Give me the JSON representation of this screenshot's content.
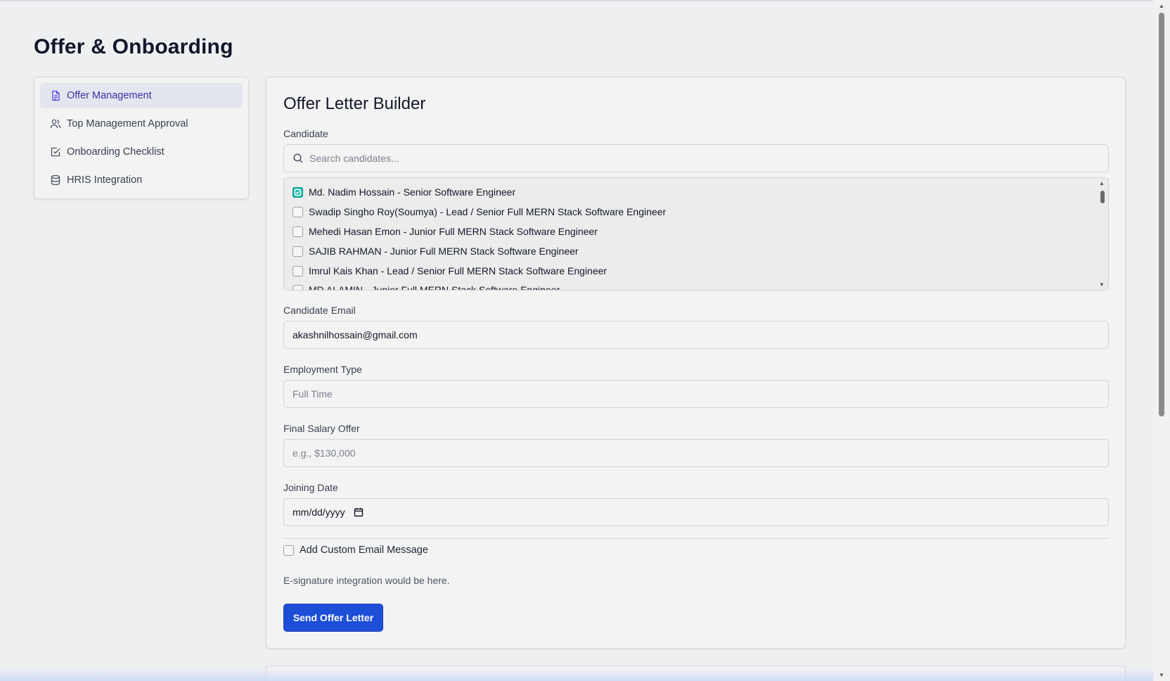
{
  "page": {
    "title": "Offer & Onboarding"
  },
  "sidebar": {
    "items": [
      {
        "label": "Offer Management",
        "icon": "document-icon",
        "active": true
      },
      {
        "label": "Top Management Approval",
        "icon": "users-icon",
        "active": false
      },
      {
        "label": "Onboarding Checklist",
        "icon": "check-square-icon",
        "active": false
      },
      {
        "label": "HRIS Integration",
        "icon": "database-icon",
        "active": false
      }
    ]
  },
  "builder": {
    "title": "Offer Letter Builder",
    "candidate_label": "Candidate",
    "search_placeholder": "Search candidates...",
    "candidates": [
      {
        "label": "Md. Nadim Hossain - Senior Software Engineer",
        "checked": true
      },
      {
        "label": "Swadip Singho Roy(Soumya) - Lead / Senior Full MERN Stack Software Engineer",
        "checked": false
      },
      {
        "label": "Mehedi Hasan Emon - Junior Full MERN Stack Software Engineer",
        "checked": false
      },
      {
        "label": "SAJIB RAHMAN - Junior Full MERN Stack Software Engineer",
        "checked": false
      },
      {
        "label": "Imrul Kais Khan - Lead / Senior Full MERN Stack Software Engineer",
        "checked": false
      },
      {
        "label": "MD ALAMIN - Junior Full MERN Stack Software Engineer",
        "checked": false
      }
    ],
    "email_label": "Candidate Email",
    "email_value": "akashnilhossain@gmail.com",
    "employment_label": "Employment Type",
    "employment_value": "Full Time",
    "salary_label": "Final Salary Offer",
    "salary_placeholder": "e.g., $130,000",
    "joining_label": "Joining Date",
    "joining_placeholder": "mm/dd/yyyy",
    "custom_message_label": "Add Custom Email Message",
    "esignature_note": "E-signature integration would be here.",
    "send_button": "Send Offer Letter"
  },
  "colors": {
    "accent": "#1d4ed8",
    "active_nav_text": "#3730a3",
    "checkbox_checked": "#14b8a6"
  }
}
